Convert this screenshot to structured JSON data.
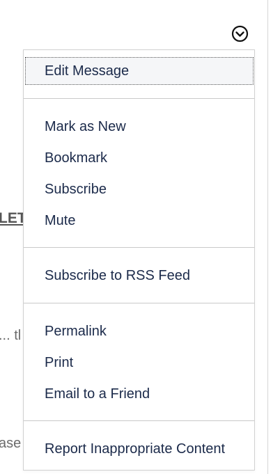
{
  "background": {
    "link_fragment": "LET",
    "ellipsis_fragment": "... tl",
    "please_fragment": "ase"
  },
  "options_toggle": {
    "icon": "chevron-down-circle-icon"
  },
  "menu": {
    "edit_message": "Edit Message",
    "mark_as_new": "Mark as New",
    "bookmark": "Bookmark",
    "subscribe": "Subscribe",
    "mute": "Mute",
    "subscribe_rss": "Subscribe to RSS Feed",
    "permalink": "Permalink",
    "print": "Print",
    "email_friend": "Email to a Friend",
    "report": "Report Inappropriate Content"
  },
  "colors": {
    "menu_text": "#1b2a4a",
    "separator": "#c9c9c9",
    "menu_border": "#d0d0d0"
  }
}
